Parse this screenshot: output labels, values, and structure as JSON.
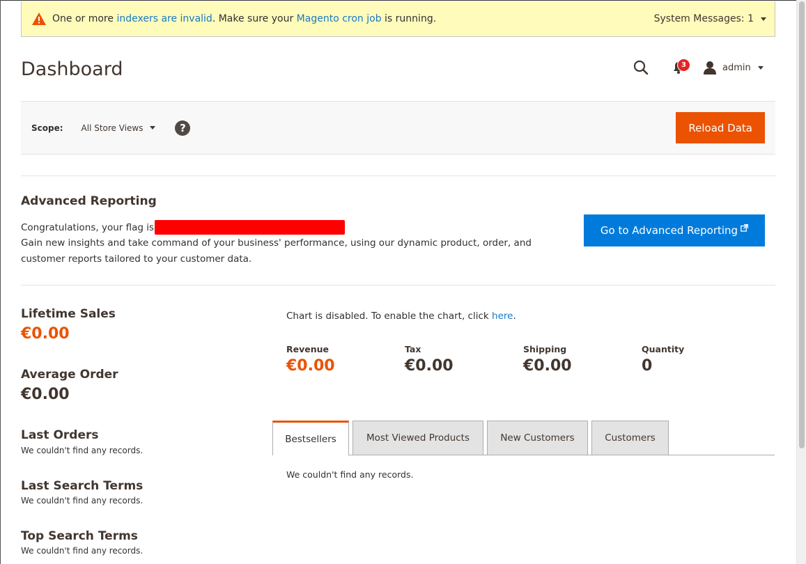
{
  "system_message": {
    "text_before": "One or more ",
    "link1": "indexers are invalid",
    "text_middle": ". Make sure your ",
    "link2": "Magento cron job",
    "text_after": " is running.",
    "counter": "System Messages: 1"
  },
  "header": {
    "title": "Dashboard",
    "notifications_count": "3",
    "user": "admin"
  },
  "scope": {
    "label": "Scope:",
    "selected": "All Store Views",
    "reload_button": "Reload Data"
  },
  "advanced_reporting": {
    "title": "Advanced Reporting",
    "flag_text": "Congratulations, your flag is",
    "description": "Gain new insights and take command of your business' performance, using our dynamic product, order, and customer reports tailored to your customer data.",
    "button": "Go to Advanced Reporting"
  },
  "stats": {
    "lifetime_sales_label": "Lifetime Sales",
    "lifetime_sales_value": "€0.00",
    "average_order_label": "Average Order",
    "average_order_value": "€0.00"
  },
  "grids": {
    "last_orders": "Last Orders",
    "last_search_terms": "Last Search Terms",
    "top_search_terms": "Top Search Terms",
    "empty": "We couldn't find any records."
  },
  "chart": {
    "disabled_text": "Chart is disabled. To enable the chart, click ",
    "link": "here",
    "period": "."
  },
  "totals": [
    {
      "label": "Revenue",
      "value": "€0.00"
    },
    {
      "label": "Tax",
      "value": "€0.00"
    },
    {
      "label": "Shipping",
      "value": "€0.00"
    },
    {
      "label": "Quantity",
      "value": "0"
    }
  ],
  "tabs": [
    {
      "label": "Bestsellers"
    },
    {
      "label": "Most Viewed Products"
    },
    {
      "label": "New Customers"
    },
    {
      "label": "Customers"
    }
  ],
  "tab_content": "We couldn't find any records.",
  "colors": {
    "accent_orange": "#eb5202",
    "link_blue": "#1979c3",
    "button_blue": "#007bdb",
    "message_bg": "#fffbbb"
  }
}
